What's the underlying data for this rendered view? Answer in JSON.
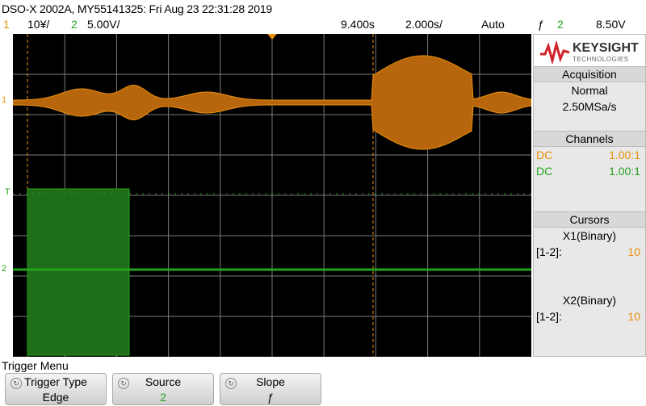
{
  "header": {
    "title": "DSO-X 2002A, MY55141325: Fri Aug 23 22:31:28 2019",
    "ch1_num": "1",
    "ch1_scale": "10¥/",
    "ch2_num": "2",
    "ch2_scale": "5.00V/",
    "time_position": "9.400s",
    "time_scale": "2.000s/",
    "trigger_mode": "Auto",
    "trigger_slope_symbol": "ƒ",
    "trigger_source": "2",
    "trigger_level": "8.50V"
  },
  "brand": {
    "name": "KEYSIGHT",
    "sub": "TECHNOLOGIES"
  },
  "acquisition": {
    "header": "Acquisition",
    "mode": "Normal",
    "rate": "2.50MSa/s"
  },
  "channels": {
    "header": "Channels",
    "rows": [
      {
        "coupling": "DC",
        "ratio": "1.00:1"
      },
      {
        "coupling": "DC",
        "ratio": "1.00:1"
      }
    ]
  },
  "cursors": {
    "header": "Cursors",
    "x1_label": "X1(Binary)",
    "x1_key": "[1-2]:",
    "x1_val": "10",
    "x2_label": "X2(Binary)",
    "x2_key": "[1-2]:",
    "x2_val": "10"
  },
  "markers": {
    "ch1": "1",
    "ch2": "2",
    "trigger": "T"
  },
  "menu": {
    "title": "Trigger Menu",
    "softkeys": [
      {
        "label": "Trigger Type",
        "value": "Edge"
      },
      {
        "label": "Source",
        "value": "2"
      },
      {
        "label": "Slope",
        "value": "ƒ"
      }
    ]
  },
  "colors": {
    "ch1": "#e8900a",
    "ch2": "#25a21c",
    "grid": "#7a7a7a"
  }
}
